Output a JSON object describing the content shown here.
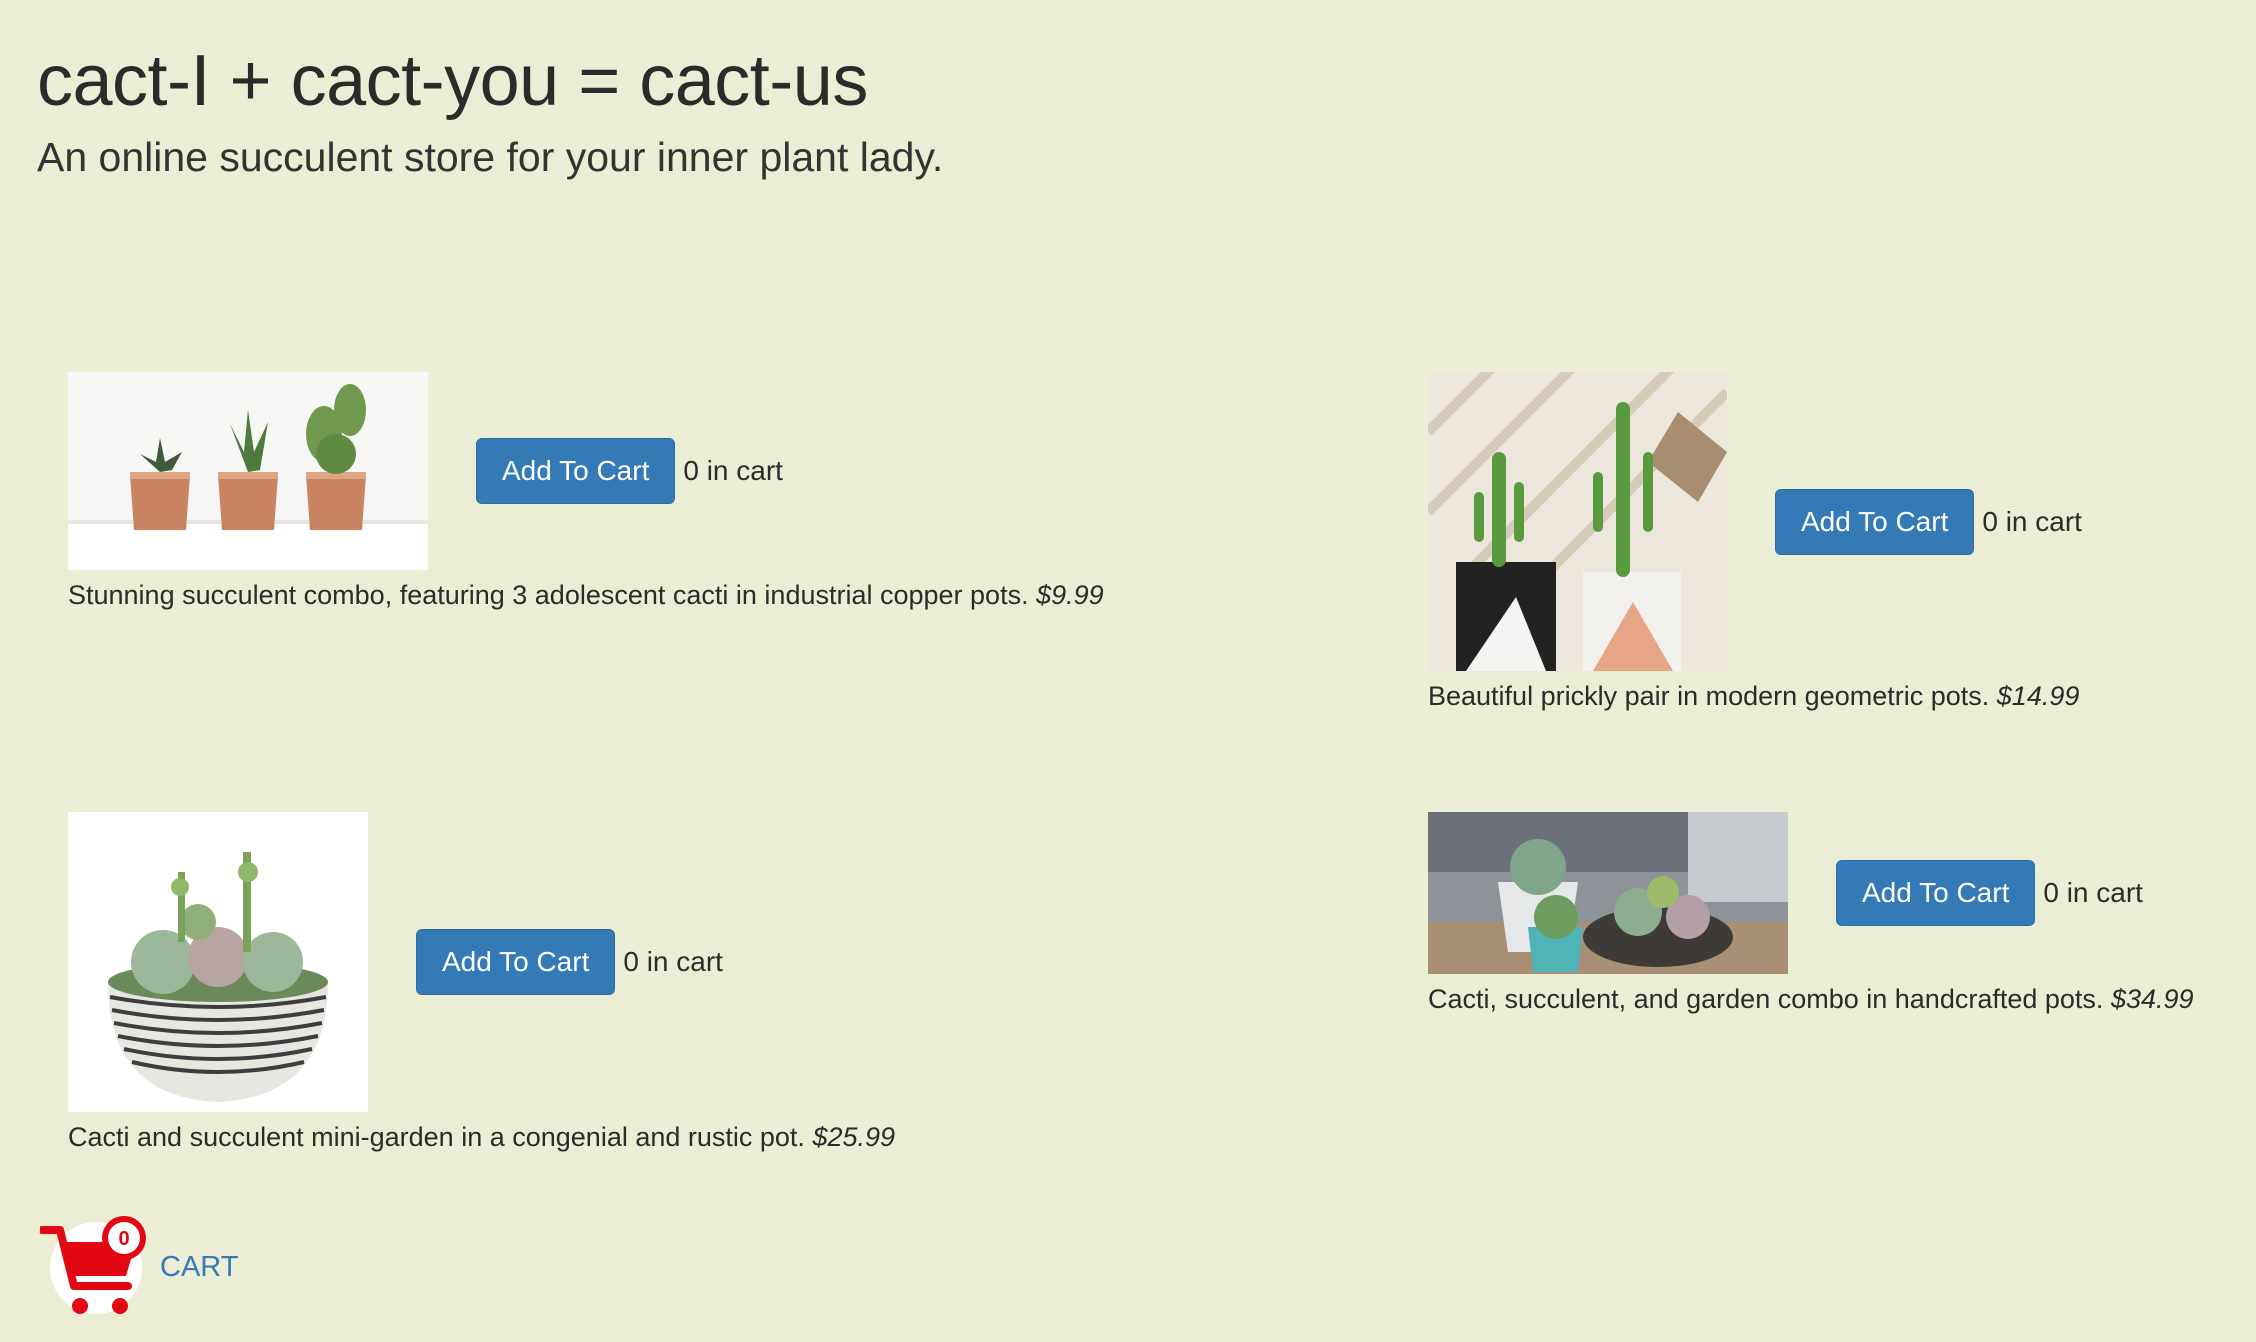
{
  "header": {
    "title": "cact-I + cact-you = cact-us",
    "tagline": "An online succulent store for your inner plant lady."
  },
  "products": [
    {
      "image_alt": "three cacti in copper pots",
      "button_label": "Add To Cart",
      "in_cart": "0 in cart",
      "description": "Stunning succulent combo, featuring 3 adolescent cacti in industrial copper pots.",
      "price": "$9.99"
    },
    {
      "image_alt": "two cacti in geometric pots",
      "button_label": "Add To Cart",
      "in_cart": "0 in cart",
      "description": "Beautiful prickly pair in modern geometric pots.",
      "price": "$14.99"
    },
    {
      "image_alt": "succulent mini-garden in striped bowl",
      "button_label": "Add To Cart",
      "in_cart": "0 in cart",
      "description": "Cacti and succulent mini-garden in a congenial and rustic pot.",
      "price": "$25.99"
    },
    {
      "image_alt": "succulents in handcrafted pots on table",
      "button_label": "Add To Cart",
      "in_cart": "0 in cart",
      "description": "Cacti, succulent, and garden combo in handcrafted pots.",
      "price": "$34.99"
    }
  ],
  "cart": {
    "count": "0",
    "label": "CART",
    "icon": "shopping-cart-icon"
  },
  "colors": {
    "background": "#ebedd4",
    "button": "#337ab7",
    "cart_icon": "#e30613"
  }
}
